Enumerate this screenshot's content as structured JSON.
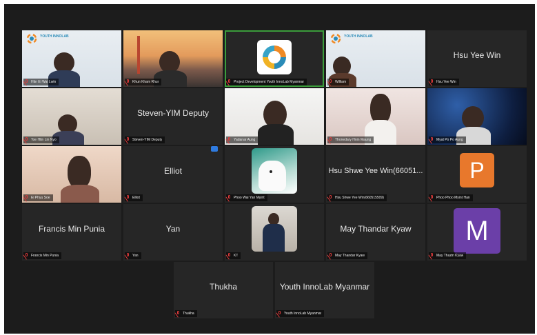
{
  "participants": [
    {
      "name": "Htin Ei Wai Lwin",
      "brand": "YOUTH INNOLAB"
    },
    {
      "name": "Khun Kham Rhur"
    },
    {
      "name": "Project Development Youth InnoLab Myanmar"
    },
    {
      "name": "William",
      "brand": "YOUTH INNOLAB"
    },
    {
      "name": "Hsu Yee Win",
      "display": "Hsu Yee Win"
    },
    {
      "name": "Toe Htin Lin Nyo"
    },
    {
      "name": "Steven-YIM Deputy",
      "display": "Steven-YIM Deputy"
    },
    {
      "name": "Yadanar Aung"
    },
    {
      "name": "Thonedary Hnin Maung"
    },
    {
      "name": "Myat Po Po Aung"
    },
    {
      "name": "Ei Phyu Soe"
    },
    {
      "name": "Elliot",
      "display": "Elliot"
    },
    {
      "name": "Phoo Wai Yan Myint"
    },
    {
      "name": "Hsu Shwe Yee Win(660515509)",
      "display": "Hsu Shwe Yee Win(66051..."
    },
    {
      "name": "Phoo Phoo Myint Han",
      "initial": "P"
    },
    {
      "name": "Francis Min Punia",
      "display": "Francis Min Punia"
    },
    {
      "name": "Yan",
      "display": "Yan"
    },
    {
      "name": "KT"
    },
    {
      "name": "May Thandar Kyaw",
      "display": "May Thandar Kyaw"
    },
    {
      "name": "May Thazin Kyaw",
      "initial": "M"
    },
    {
      "name": "Thukha",
      "display": "Thukha"
    },
    {
      "name": "Youth InnoLab Myanmar",
      "display": "Youth InnoLab Myanmar"
    }
  ],
  "colors": {
    "background": "#1c1c1c",
    "tile": "#262626",
    "active_speaker_border": "#3b9d3b",
    "muted_icon": "#e03b3b",
    "avatar_p": "#e8782c",
    "avatar_m": "#6b3fa8"
  },
  "icons": {
    "mic_status": "mic-muted-icon",
    "logo": "youth-innolab-logo"
  }
}
